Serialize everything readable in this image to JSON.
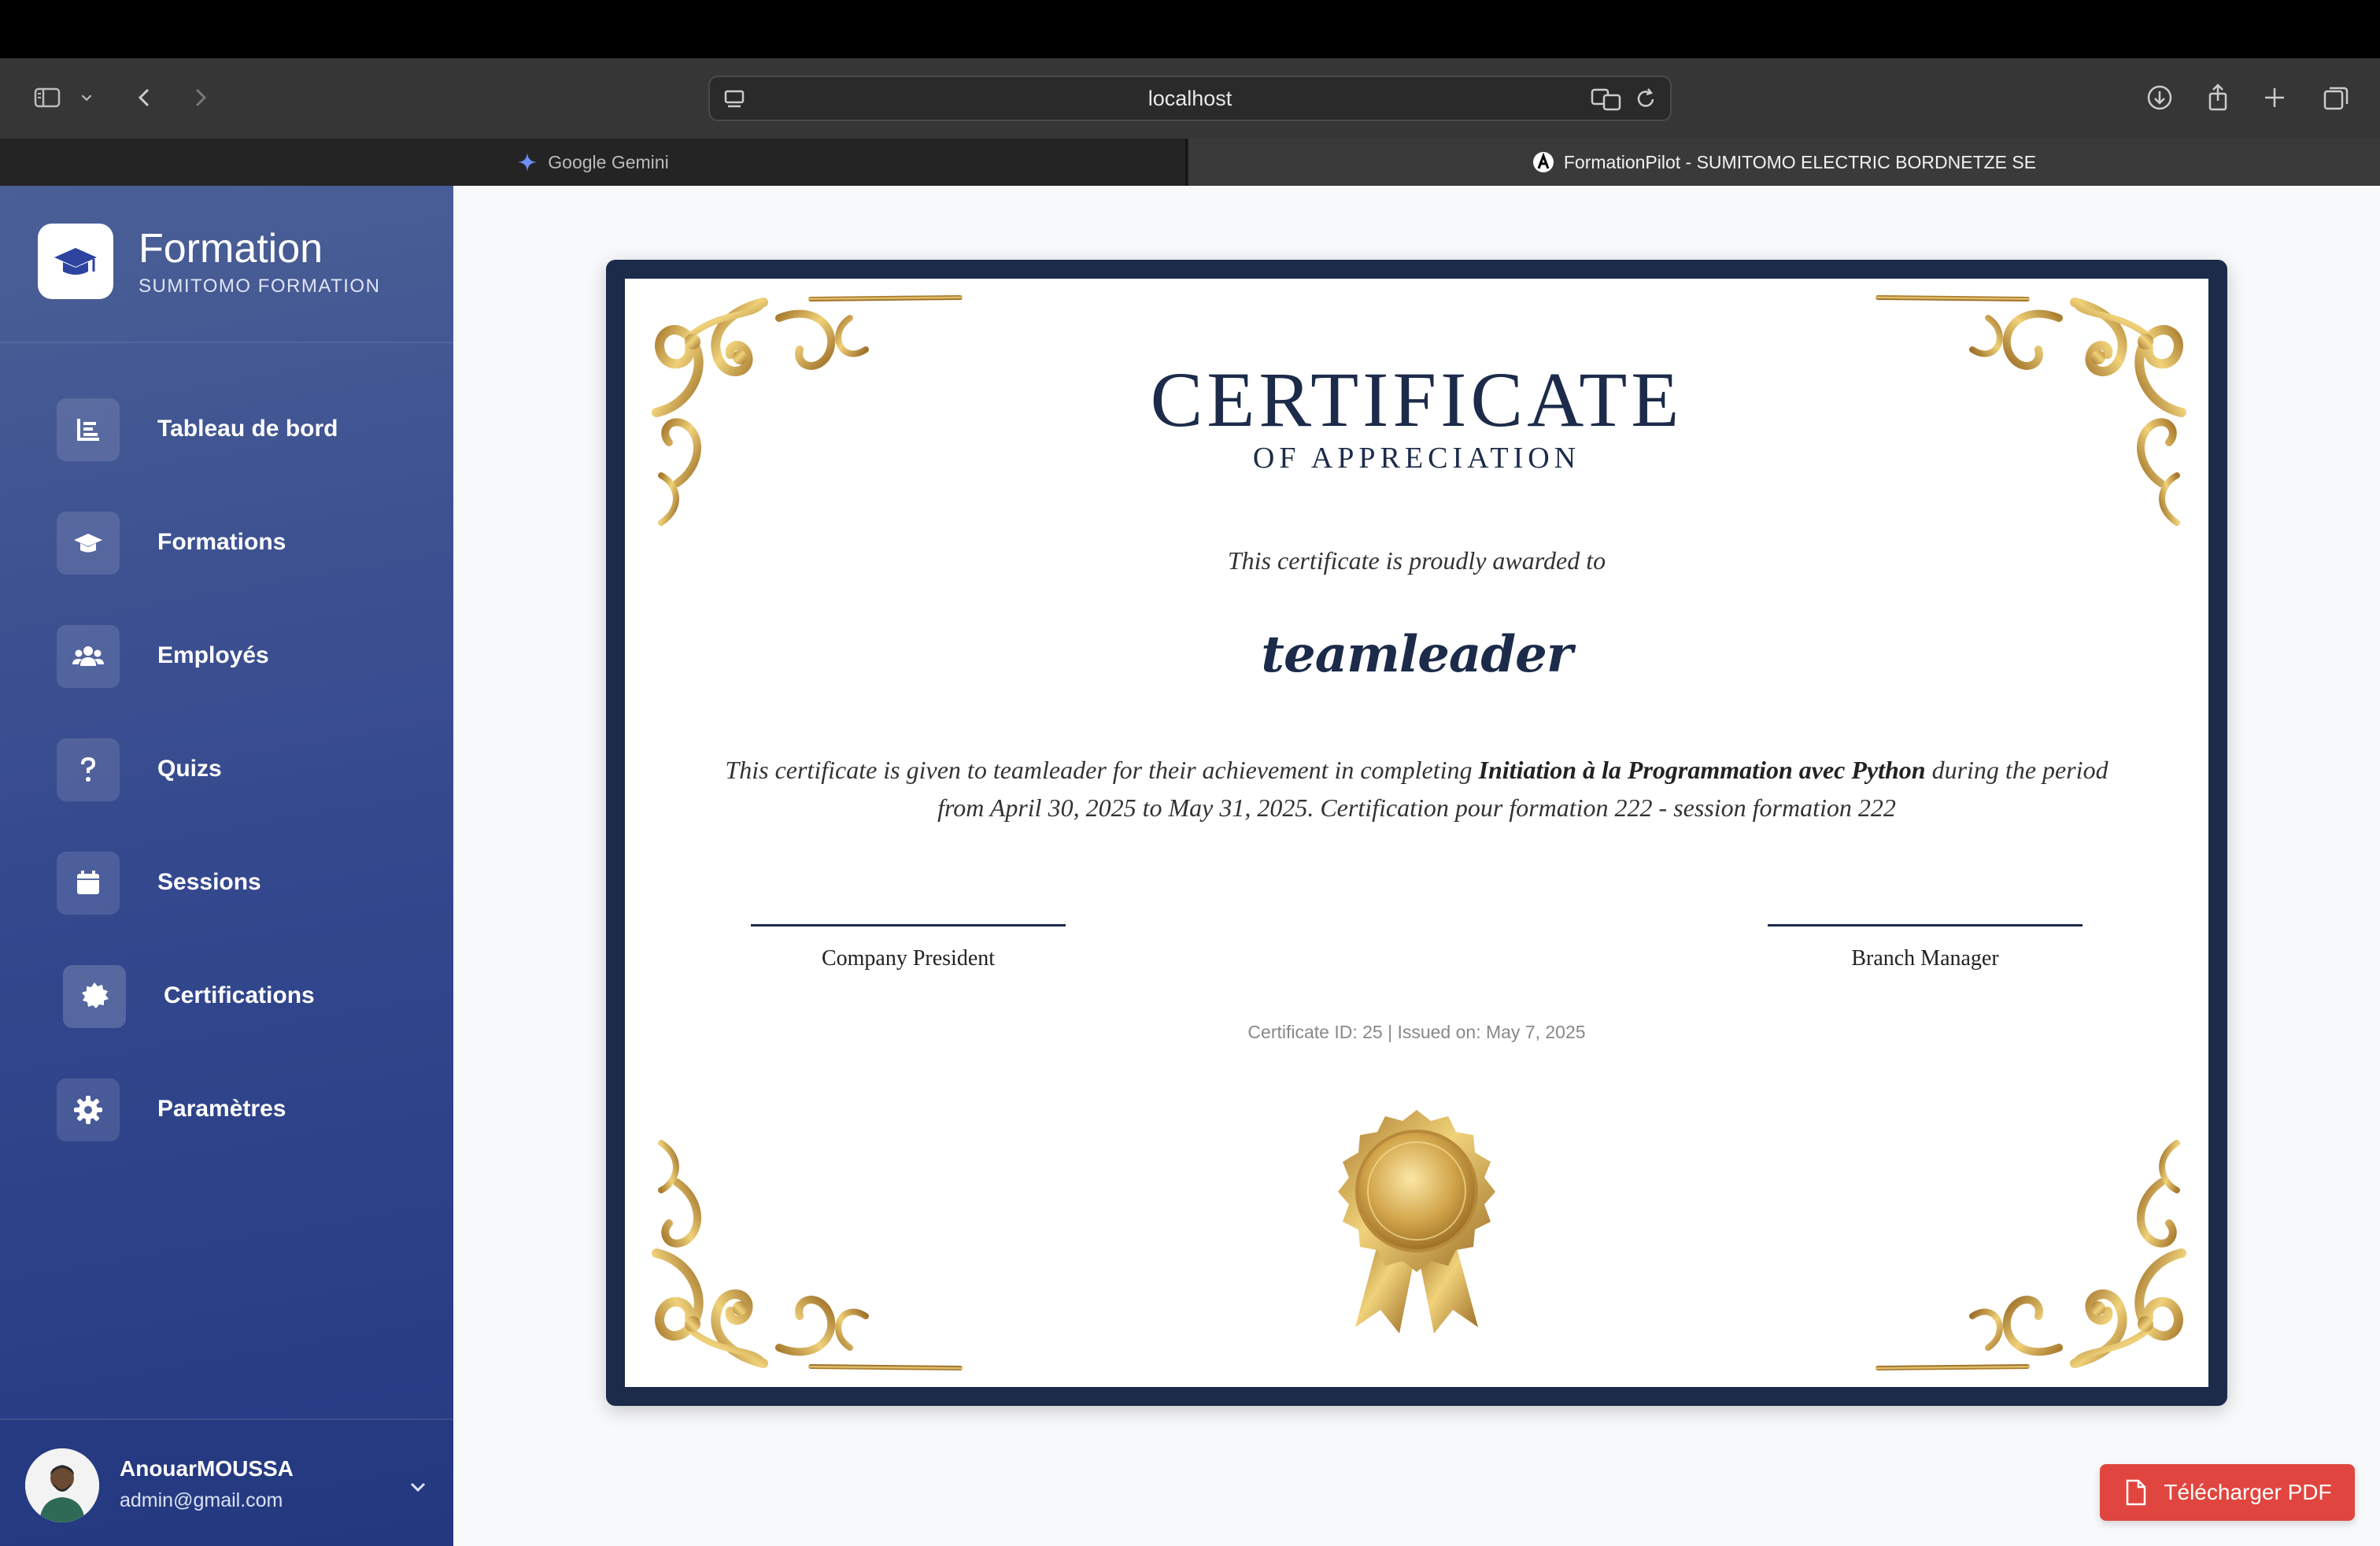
{
  "browser": {
    "url": "localhost",
    "tabs": [
      {
        "label": "Google Gemini"
      },
      {
        "label": "FormationPilot - SUMITOMO ELECTRIC BORDNETZE SE"
      }
    ]
  },
  "sidebar": {
    "brand_title": "Formation",
    "brand_subtitle": "SUMITOMO FORMATION",
    "items": [
      {
        "label": "Tableau de bord",
        "icon": "dashboard-icon"
      },
      {
        "label": "Formations",
        "icon": "graduation-cap-icon"
      },
      {
        "label": "Employés",
        "icon": "users-icon"
      },
      {
        "label": "Quizs",
        "icon": "question-icon"
      },
      {
        "label": "Sessions",
        "icon": "calendar-icon"
      },
      {
        "label": "Certifications",
        "icon": "certificate-icon",
        "active": true
      },
      {
        "label": "Paramètres",
        "icon": "gear-icon"
      }
    ],
    "user": {
      "name": "AnouarMOUSSA",
      "email": "admin@gmail.com"
    }
  },
  "certificate": {
    "title": "CERTIFICATE",
    "subtitle": "OF APPRECIATION",
    "awarded_text": "This certificate is proudly awarded to",
    "recipient": "teamleader",
    "desc_part1": "This certificate is given to teamleader for their achievement in completing ",
    "course": "Initiation à la Programmation avec Python",
    "desc_part2": " during the period from April 30, 2025 to May 31, 2025. Certification pour formation 222 - session formation 222",
    "signature_left": "Company President",
    "signature_right": "Branch Manager",
    "meta": "Certificate ID: 25 | Issued on: May 7, 2025"
  },
  "actions": {
    "download_pdf": "Télécharger PDF"
  },
  "colors": {
    "sidebar_gradient_start": "#4b5f96",
    "sidebar_gradient_end": "#253a82",
    "certificate_navy": "#1c2b4a",
    "gold": "#c9a14a",
    "pdf_button": "#e0463f"
  }
}
